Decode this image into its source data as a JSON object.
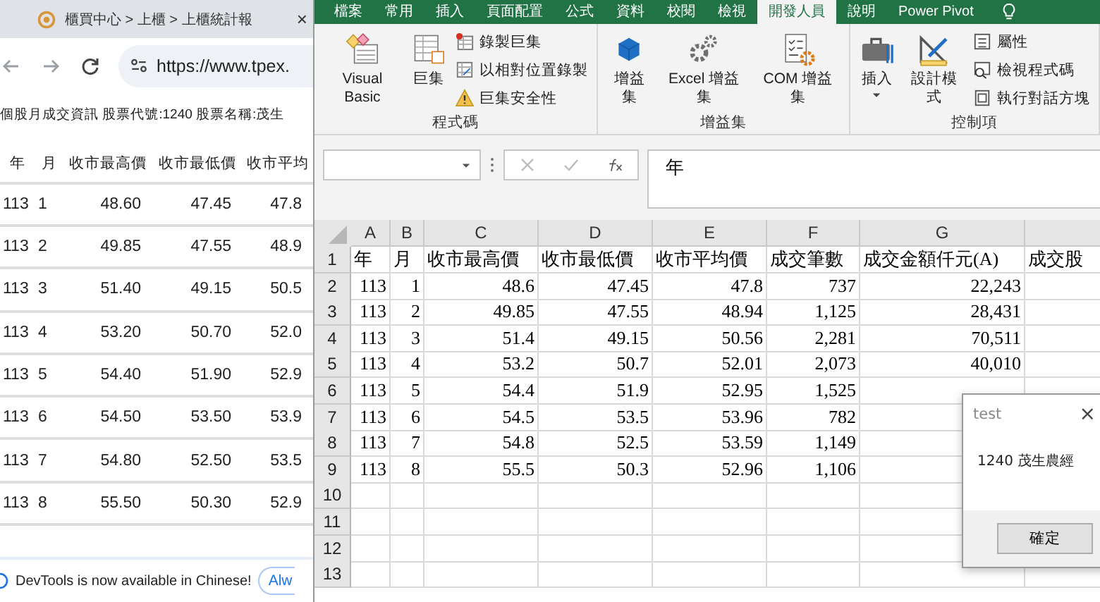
{
  "browser": {
    "tab": {
      "title": "櫃買中心 > 上櫃 > 上櫃統計報",
      "close": "×"
    },
    "url": "https://www.tpex.",
    "caption": "個股月成交資訊 股票代號:1240 股票名稱:茂生",
    "table": {
      "columns": [
        "年",
        "月",
        "收市最高價",
        "收市最低價",
        "收市平均"
      ],
      "rows": [
        [
          "113",
          "1",
          "48.60",
          "47.45",
          "47.8"
        ],
        [
          "113",
          "2",
          "49.85",
          "47.55",
          "48.9"
        ],
        [
          "113",
          "3",
          "51.40",
          "49.15",
          "50.5"
        ],
        [
          "113",
          "4",
          "53.20",
          "50.70",
          "52.0"
        ],
        [
          "113",
          "5",
          "54.40",
          "51.90",
          "52.9"
        ],
        [
          "113",
          "6",
          "54.50",
          "53.50",
          "53.9"
        ],
        [
          "113",
          "7",
          "54.80",
          "52.50",
          "53.5"
        ],
        [
          "113",
          "8",
          "55.50",
          "50.30",
          "52.9"
        ]
      ]
    },
    "devtools_banner": {
      "message": "DevTools is now available in Chinese!",
      "button": "Alw"
    }
  },
  "excel": {
    "ribbon_tabs": [
      {
        "label": "檔案",
        "selected": false
      },
      {
        "label": "常用",
        "selected": false
      },
      {
        "label": "插入",
        "selected": false
      },
      {
        "label": "頁面配置",
        "selected": false
      },
      {
        "label": "公式",
        "selected": false
      },
      {
        "label": "資料",
        "selected": false
      },
      {
        "label": "校閱",
        "selected": false
      },
      {
        "label": "檢視",
        "selected": false
      },
      {
        "label": "開發人員",
        "selected": true
      },
      {
        "label": "說明",
        "selected": false
      },
      {
        "label": "Power Pivot",
        "selected": false
      }
    ],
    "ribbon_groups": [
      {
        "title": "程式碼",
        "large": [
          {
            "label": "Visual Basic"
          },
          {
            "label": "巨集"
          }
        ],
        "small": [
          "錄製巨集",
          "以相對位置錄製",
          "巨集安全性"
        ]
      },
      {
        "title": "增益集",
        "large": [
          {
            "label": "增益集"
          },
          {
            "label": "Excel 增益集"
          },
          {
            "label": "COM 增益集"
          }
        ]
      },
      {
        "title": "控制項",
        "large": [
          {
            "label": "插入",
            "dropdown": true
          },
          {
            "label": "設計模式"
          }
        ],
        "small": [
          "屬性",
          "檢視程式碼",
          "執行對話方塊"
        ]
      }
    ],
    "formula_bar": {
      "value": "年"
    },
    "sheet": {
      "columns": [
        "A",
        "B",
        "C",
        "D",
        "E",
        "F",
        "G"
      ],
      "rows": [
        {
          "number": "1",
          "cells": [
            "年",
            "月",
            "收市最高價",
            "收市最低價",
            "收市平均價",
            "成交筆數",
            "成交金額仟元(A)",
            "成交股"
          ]
        },
        {
          "number": "2",
          "cells": [
            "113",
            "1",
            "48.6",
            "47.45",
            "47.8",
            "737",
            "22,243"
          ]
        },
        {
          "number": "3",
          "cells": [
            "113",
            "2",
            "49.85",
            "47.55",
            "48.94",
            "1,125",
            "28,431"
          ]
        },
        {
          "number": "4",
          "cells": [
            "113",
            "3",
            "51.4",
            "49.15",
            "50.56",
            "2,281",
            "70,511"
          ]
        },
        {
          "number": "5",
          "cells": [
            "113",
            "4",
            "53.2",
            "50.7",
            "52.01",
            "2,073",
            "40,010"
          ]
        },
        {
          "number": "6",
          "cells": [
            "113",
            "5",
            "54.4",
            "51.9",
            "52.95",
            "1,525"
          ]
        },
        {
          "number": "7",
          "cells": [
            "113",
            "6",
            "54.5",
            "53.5",
            "53.96",
            "782"
          ]
        },
        {
          "number": "8",
          "cells": [
            "113",
            "7",
            "54.8",
            "52.5",
            "53.59",
            "1,149"
          ]
        },
        {
          "number": "9",
          "cells": [
            "113",
            "8",
            "55.5",
            "50.3",
            "52.96",
            "1,106"
          ]
        },
        {
          "number": "10"
        },
        {
          "number": "11"
        },
        {
          "number": "12"
        },
        {
          "number": "13"
        }
      ]
    },
    "dialog": {
      "title": "test",
      "close": "×",
      "message": "1240 茂生農經",
      "button": "確定"
    }
  }
}
